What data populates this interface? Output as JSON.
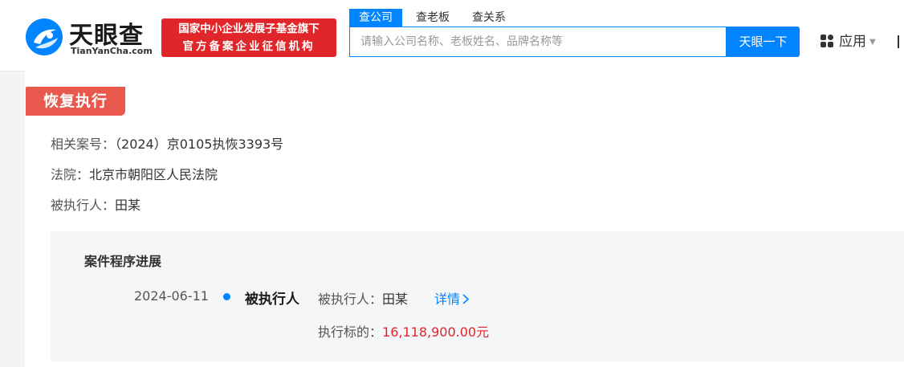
{
  "header": {
    "logo_text": "天眼查",
    "logo_sub": "TianYanCha.com",
    "banner_line1": "国家中小企业发展子基金旗下",
    "banner_line2": "官方备案企业征信机构",
    "search_tabs": [
      "查公司",
      "查老板",
      "查关系"
    ],
    "search_placeholder": "请输入公司名称、老板姓名、品牌名称等",
    "search_button": "天眼一下",
    "apps_label": "应用"
  },
  "section": {
    "tag": "恢复执行",
    "rows": [
      {
        "label": "相关案号：",
        "value": "（2024）京0105执恢3393号"
      },
      {
        "label": "法院：",
        "value": "北京市朝阳区人民法院"
      },
      {
        "label": "被执行人：",
        "value": "田某"
      }
    ]
  },
  "progress": {
    "title": "案件程序进展",
    "entry": {
      "date": "2024-06-11",
      "role": "被执行人",
      "detail_label": "被执行人：",
      "detail_value": "田某",
      "link": "详情",
      "amount_label": "执行标的：",
      "amount_value": "16,118,900.00元"
    }
  },
  "colors": {
    "brand_blue": "#0084ff",
    "banner_red": "#e0262b",
    "tag_red": "#e8584d",
    "amount_red": "#e0262b"
  },
  "icons": [
    "tianyancha-logo-icon",
    "apps-grid-icon",
    "caret-down-icon",
    "chevron-right-icon"
  ]
}
